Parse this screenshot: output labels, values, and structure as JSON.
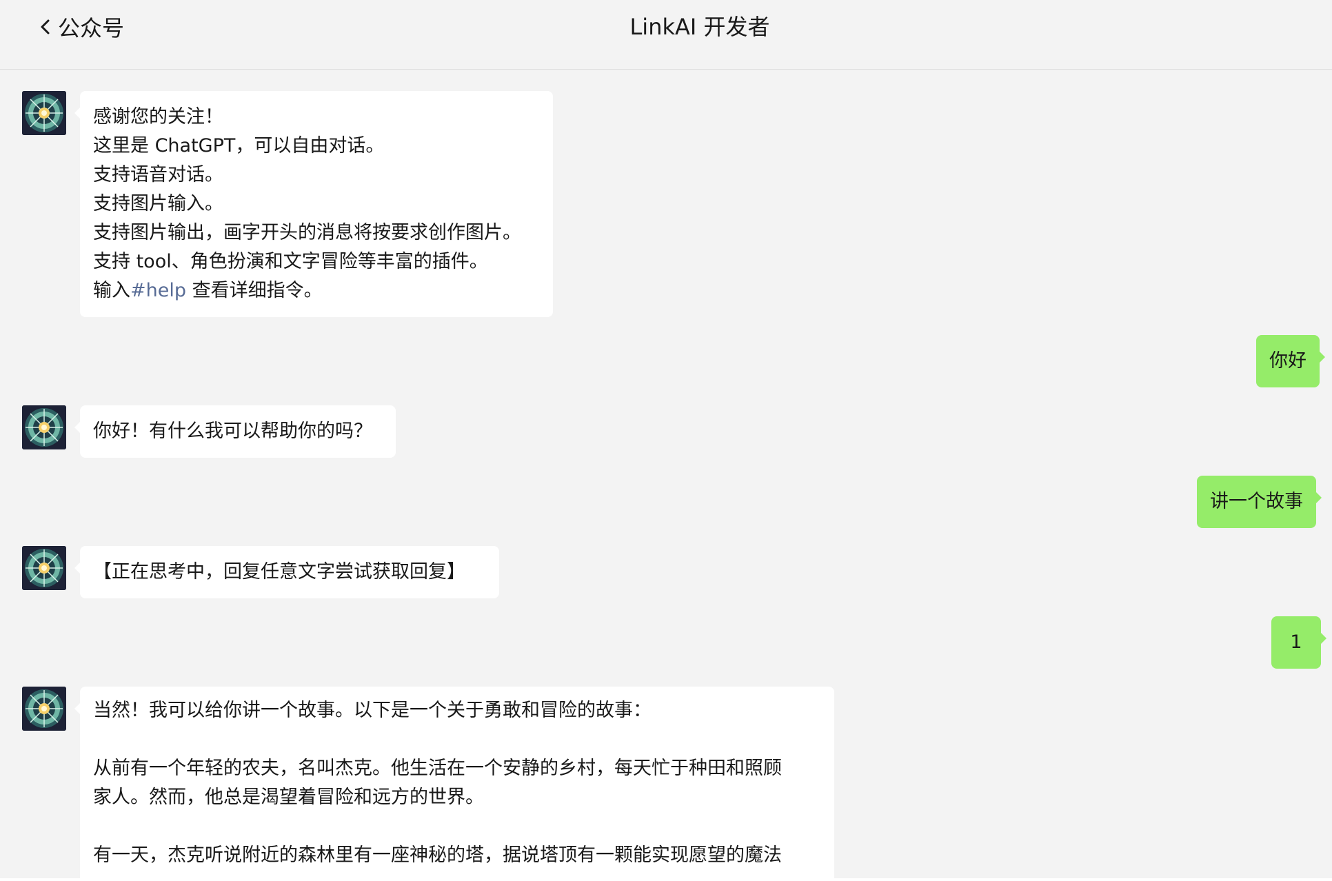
{
  "header": {
    "back_label": "公众号",
    "title": "LinkAI 开发者"
  },
  "messages": [
    {
      "sender": "bot",
      "lines": [
        "感谢您的关注！",
        "这里是 ChatGPT，可以自由对话。",
        "支持语音对话。",
        "支持图片输入。",
        "支持图片输出，画字开头的消息将按要求创作图片。",
        "支持 tool、角色扮演和文字冒险等丰富的插件。"
      ],
      "last_prefix": "输入",
      "last_link": "#help",
      "last_suffix": " 查看详细指令。"
    },
    {
      "sender": "user",
      "text": "你好"
    },
    {
      "sender": "bot",
      "text": "你好！有什么我可以帮助你的吗？"
    },
    {
      "sender": "user",
      "text": "讲一个故事"
    },
    {
      "sender": "bot",
      "text": "【正在思考中，回复任意文字尝试获取回复】"
    },
    {
      "sender": "user",
      "text": "1"
    },
    {
      "sender": "bot",
      "lines": [
        "当然！我可以给你讲一个故事。以下是一个关于勇敢和冒险的故事：",
        "",
        "从前有一个年轻的农夫，名叫杰克。他生活在一个安静的乡村，每天忙于种田和照顾",
        "家人。然而，他总是渴望着冒险和远方的世界。",
        "",
        "有一天，杰克听说附近的森林里有一座神秘的塔，据说塔顶有一颗能实现愿望的魔法"
      ]
    }
  ],
  "colors": {
    "chat_background": "#f3f3f3",
    "incoming_bubble": "#ffffff",
    "outgoing_bubble": "#95ec69",
    "link": "#576b95"
  },
  "icons": {
    "back": "chevron-left-icon",
    "avatar": "linkai-orb-avatar"
  }
}
